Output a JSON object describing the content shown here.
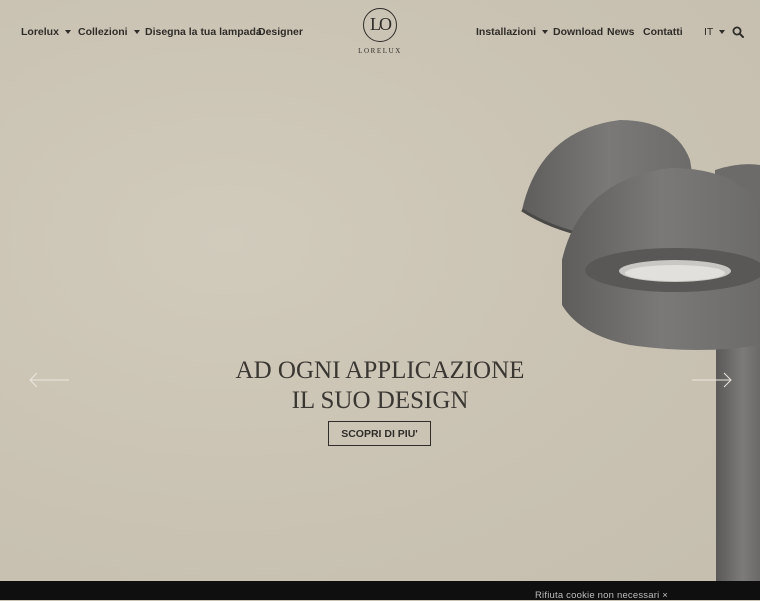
{
  "nav": {
    "left": [
      {
        "label": "Lorelux",
        "dropdown": true
      },
      {
        "label": "Collezioni",
        "dropdown": true
      },
      {
        "label": "Disegna la tua lampada",
        "dropdown": false
      },
      {
        "label": "Designer",
        "dropdown": false
      }
    ],
    "right": [
      {
        "label": "Installazioni",
        "dropdown": true
      },
      {
        "label": "Download",
        "dropdown": false
      },
      {
        "label": "News",
        "dropdown": false
      },
      {
        "label": "Contatti",
        "dropdown": false
      }
    ],
    "language": "IT",
    "search_icon": "search-icon"
  },
  "logo": {
    "monogram": "LO",
    "wordmark": "LORELUX"
  },
  "hero": {
    "headline_line1": "AD OGNI APPLICAZIONE",
    "headline_line2": "IL SUO DESIGN",
    "cta_label": "SCOPRI DI PIU'",
    "prev_icon": "arrow-left-icon",
    "next_icon": "arrow-right-icon"
  },
  "cookie_bar": {
    "reject_label": "Rifiuta cookie non necessari ×"
  },
  "colors": {
    "background": "#cbc4b4",
    "text": "#2f2d2a",
    "lamp": "#6a6967",
    "cookie_bar": "#0f0f0f"
  }
}
